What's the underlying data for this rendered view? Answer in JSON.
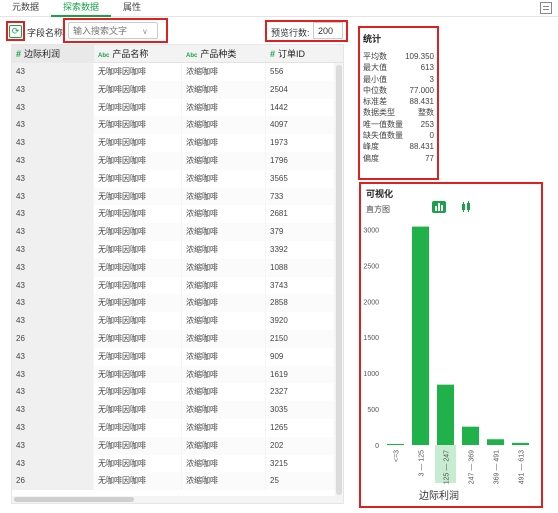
{
  "tabs": [
    {
      "label": "元数据"
    },
    {
      "label": "探索数据"
    },
    {
      "label": "属性"
    }
  ],
  "toolbar": {
    "field_label": "字段名称:",
    "search_placeholder": "输入搜索文字",
    "rows_label": "预览行数:",
    "rows_value": "200"
  },
  "table": {
    "columns": [
      {
        "type_icon": "#",
        "label": "边际利润"
      },
      {
        "type_icon": "Abc",
        "label": "产品名称"
      },
      {
        "type_icon": "Abc",
        "label": "产品种类"
      },
      {
        "type_icon": "#",
        "label": "订单ID"
      }
    ],
    "rows": [
      [
        "43",
        "无咖啡因咖啡",
        "浓缩咖啡",
        "556"
      ],
      [
        "43",
        "无咖啡因咖啡",
        "浓缩咖啡",
        "2504"
      ],
      [
        "43",
        "无咖啡因咖啡",
        "浓缩咖啡",
        "1442"
      ],
      [
        "43",
        "无咖啡因咖啡",
        "浓缩咖啡",
        "4097"
      ],
      [
        "43",
        "无咖啡因咖啡",
        "浓缩咖啡",
        "1973"
      ],
      [
        "43",
        "无咖啡因咖啡",
        "浓缩咖啡",
        "1796"
      ],
      [
        "43",
        "无咖啡因咖啡",
        "浓缩咖啡",
        "3565"
      ],
      [
        "43",
        "无咖啡因咖啡",
        "浓缩咖啡",
        "733"
      ],
      [
        "43",
        "无咖啡因咖啡",
        "浓缩咖啡",
        "2681"
      ],
      [
        "43",
        "无咖啡因咖啡",
        "浓缩咖啡",
        "379"
      ],
      [
        "43",
        "无咖啡因咖啡",
        "浓缩咖啡",
        "3392"
      ],
      [
        "43",
        "无咖啡因咖啡",
        "浓缩咖啡",
        "1088"
      ],
      [
        "43",
        "无咖啡因咖啡",
        "浓缩咖啡",
        "3743"
      ],
      [
        "43",
        "无咖啡因咖啡",
        "浓缩咖啡",
        "2858"
      ],
      [
        "43",
        "无咖啡因咖啡",
        "浓缩咖啡",
        "3920"
      ],
      [
        "26",
        "无咖啡因咖啡",
        "浓缩咖啡",
        "2150"
      ],
      [
        "43",
        "无咖啡因咖啡",
        "浓缩咖啡",
        "909"
      ],
      [
        "43",
        "无咖啡因咖啡",
        "浓缩咖啡",
        "1619"
      ],
      [
        "43",
        "无咖啡因咖啡",
        "浓缩咖啡",
        "2327"
      ],
      [
        "43",
        "无咖啡因咖啡",
        "浓缩咖啡",
        "3035"
      ],
      [
        "43",
        "无咖啡因咖啡",
        "浓缩咖啡",
        "1265"
      ],
      [
        "43",
        "无咖啡因咖啡",
        "浓缩咖啡",
        "202"
      ],
      [
        "43",
        "无咖啡因咖啡",
        "浓缩咖啡",
        "3215"
      ],
      [
        "26",
        "无咖啡因咖啡",
        "浓缩咖啡",
        "25"
      ]
    ]
  },
  "stats": {
    "title": "统计",
    "rows": [
      {
        "label": "平均数",
        "value": "109.350"
      },
      {
        "label": "最大值",
        "value": "613"
      },
      {
        "label": "最小值",
        "value": "3"
      },
      {
        "label": "中位数",
        "value": "77.000"
      },
      {
        "label": "标准差",
        "value": "88.431"
      },
      {
        "label": "数据类型",
        "value": "整数"
      },
      {
        "label": "唯一值数量",
        "value": "253"
      },
      {
        "label": "缺失值数量",
        "value": "0"
      },
      {
        "label": "峰度",
        "value": "88.431"
      },
      {
        "label": "偏度",
        "value": "77"
      }
    ]
  },
  "visualization": {
    "title": "可视化",
    "subtitle": "直方图",
    "chart_buttons": [
      {
        "icon": "histogram-icon",
        "active": true
      },
      {
        "icon": "boxplot-icon",
        "active": false
      }
    ]
  },
  "chart_data": {
    "type": "bar",
    "categories": [
      "<=3",
      "3 — 125",
      "125 — 247",
      "247 — 369",
      "369 — 491",
      "491 — 613"
    ],
    "values": [
      15,
      3040,
      840,
      255,
      80,
      30
    ],
    "ylim": [
      0,
      3000
    ],
    "yticks": [
      0,
      500,
      1000,
      1500,
      2000,
      2500,
      3000
    ],
    "xlabel": "边际利润",
    "highlighted_category": "125 — 247",
    "bar_color": "#21b14a",
    "highlight_color": "#c7ecd2",
    "grid": false
  },
  "colors": {
    "accent": "#1aa14a",
    "annotation_border": "#e02020"
  }
}
